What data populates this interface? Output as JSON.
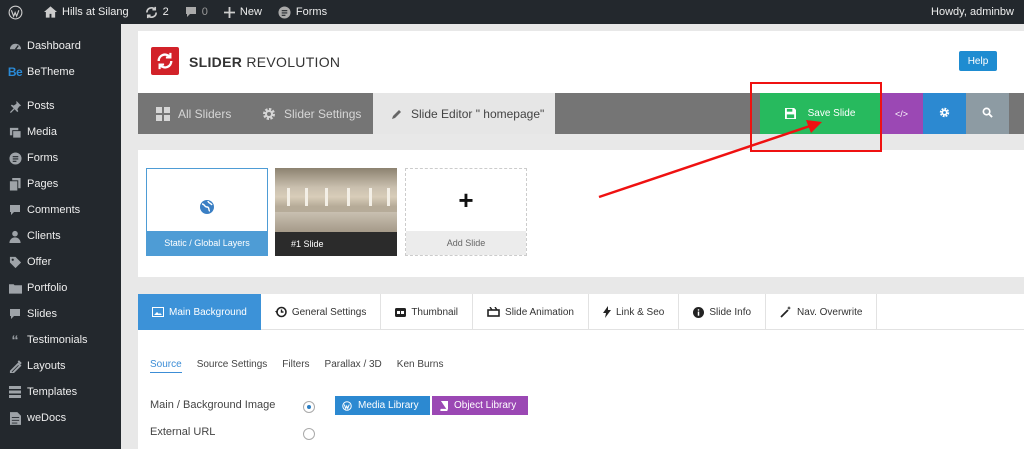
{
  "adminbar": {
    "site_name": "Hills at Silang",
    "updates_count": "2",
    "comments_count": "0",
    "new_label": "New",
    "forms_label": "Forms",
    "howdy": "Howdy, adminbw"
  },
  "sidebar": {
    "items": [
      {
        "label": "Dashboard",
        "icon": "dashboard-icon"
      },
      {
        "label": "BeTheme",
        "icon": "be-icon"
      },
      {
        "label": "Posts",
        "icon": "pin-icon"
      },
      {
        "label": "Media",
        "icon": "media-icon"
      },
      {
        "label": "Forms",
        "icon": "forms-icon"
      },
      {
        "label": "Pages",
        "icon": "pages-icon"
      },
      {
        "label": "Comments",
        "icon": "comment-icon"
      },
      {
        "label": "Clients",
        "icon": "clients-icon"
      },
      {
        "label": "Offer",
        "icon": "offer-icon"
      },
      {
        "label": "Portfolio",
        "icon": "portfolio-icon"
      },
      {
        "label": "Slides",
        "icon": "slides-icon"
      },
      {
        "label": "Testimonials",
        "icon": "quote-icon"
      },
      {
        "label": "Layouts",
        "icon": "layouts-icon"
      },
      {
        "label": "Templates",
        "icon": "templates-icon"
      },
      {
        "label": "weDocs",
        "icon": "docs-icon"
      }
    ],
    "be_badge": "Be"
  },
  "rs": {
    "brand_bold": "SLIDER",
    "brand_light": " REVOLUTION",
    "help": "Help"
  },
  "toolbar": {
    "all_sliders": "All Sliders",
    "slider_settings": "Slider Settings",
    "slide_editor": "Slide Editor \" homepage\"",
    "save_slide": "Save Slide",
    "code": "</>"
  },
  "slides": {
    "static_label": "Static / Global Layers",
    "slide1_label": "#1 Slide",
    "add_plus": "+",
    "add_label": "Add Slide"
  },
  "tabs": [
    {
      "label": "Main Background",
      "icon": "image-icon"
    },
    {
      "label": "General Settings",
      "icon": "history-icon"
    },
    {
      "label": "Thumbnail",
      "icon": "thumbnail-icon"
    },
    {
      "label": "Slide Animation",
      "icon": "animation-icon"
    },
    {
      "label": "Link & Seo",
      "icon": "bolt-icon"
    },
    {
      "label": "Slide Info",
      "icon": "info-icon"
    },
    {
      "label": "Nav. Overwrite",
      "icon": "magic-icon"
    }
  ],
  "subtabs": [
    "Source",
    "Source Settings",
    "Filters",
    "Parallax / 3D",
    "Ken Burns"
  ],
  "source": {
    "main_bg_label": "Main / Background Image",
    "external_url_label": "External URL",
    "media_library": "Media Library",
    "object_library": "Object Library"
  },
  "colors": {
    "save_green": "#27ba5e",
    "purple": "#9b48b4",
    "blue": "#2c89d1",
    "annotation_red": "#ef1111"
  }
}
